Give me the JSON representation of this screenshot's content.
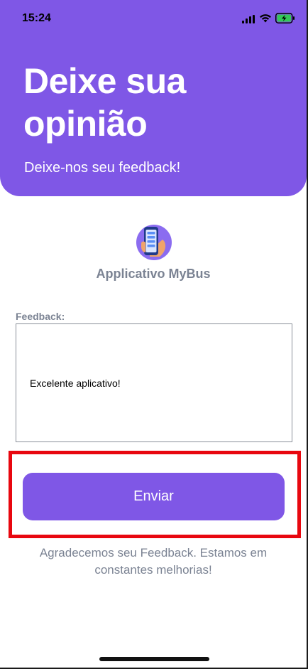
{
  "status_bar": {
    "time": "15:24"
  },
  "header": {
    "title": "Deixe sua opinião",
    "subtitle": "Deixe-nos seu feedback!"
  },
  "app": {
    "name": "Applicativo MyBus",
    "logo_icon": "phone-in-hand-icon"
  },
  "feedback": {
    "label": "Feedback:",
    "value": "Excelente aplicativo!"
  },
  "send_button": {
    "label": "Enviar"
  },
  "thanks_message": "Agradecemos seu Feedback. Estamos em constantes melhorias!",
  "colors": {
    "accent": "#7f57e6",
    "muted_text": "#7b8393",
    "highlight": "#e8070f",
    "battery": "#34c759"
  }
}
